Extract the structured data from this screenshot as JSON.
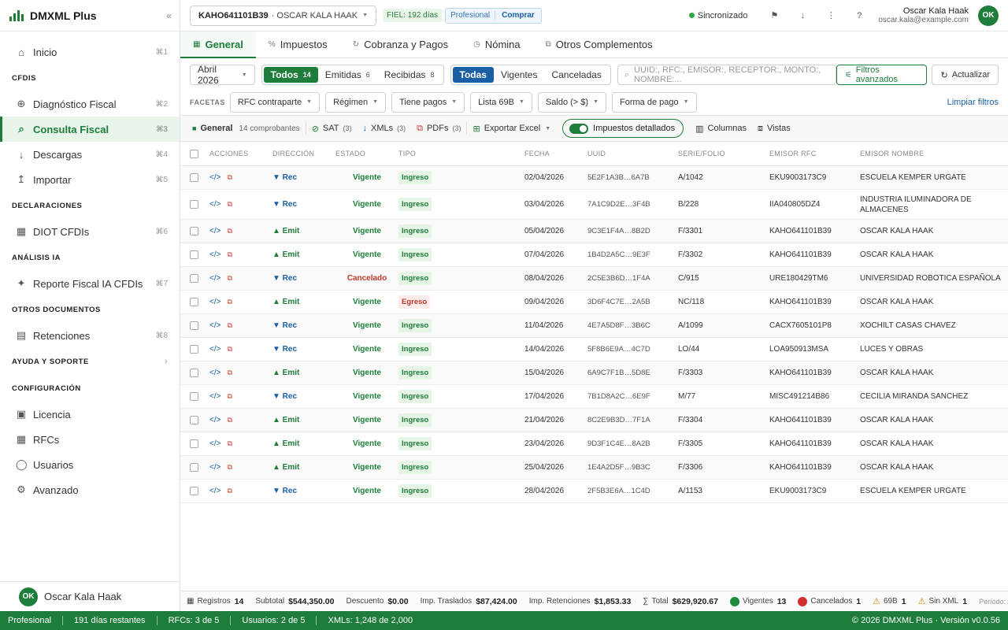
{
  "sidebar": {
    "brand": "DMXML Plus",
    "collapse_icon": "«",
    "items": [
      {
        "id": "inicio",
        "label": "Inicio",
        "icon": "⌂",
        "shortcut": "⌘1"
      },
      {
        "id": "sec-cfdis",
        "section": "CFDIS"
      },
      {
        "id": "diagnostico",
        "label": "Diagnóstico Fiscal",
        "icon": "⊕",
        "shortcut": "⌘2"
      },
      {
        "id": "consulta",
        "label": "Consulta Fiscal",
        "icon": "⌕",
        "shortcut": "⌘3",
        "active": true
      },
      {
        "id": "descargas",
        "label": "Descargas",
        "icon": "↓",
        "shortcut": "⌘4"
      },
      {
        "id": "importar",
        "label": "Importar",
        "icon": "↥",
        "shortcut": "⌘5"
      },
      {
        "id": "sec-decl",
        "section": "DECLARACIONES"
      },
      {
        "id": "diot",
        "label": "DIOT CFDIs",
        "icon": "▦",
        "shortcut": "⌘6"
      },
      {
        "id": "sec-ia",
        "section": "ANÁLISIS IA"
      },
      {
        "id": "reporte",
        "label": "Reporte Fiscal IA CFDIs",
        "icon": "✦",
        "shortcut": "⌘7"
      },
      {
        "id": "sec-otros",
        "section": "OTROS DOCUMENTOS"
      },
      {
        "id": "retenciones",
        "label": "Retenciones",
        "icon": "▤",
        "shortcut": "⌘8"
      },
      {
        "id": "sec-ayuda",
        "section": "AYUDA Y SOPORTE",
        "chevron": "›"
      },
      {
        "id": "sec-config",
        "section": "CONFIGURACIÓN"
      },
      {
        "id": "licencia",
        "label": "Licencia",
        "icon": "▣",
        "shortcut": ""
      },
      {
        "id": "rfcs",
        "label": "RFCs",
        "icon": "▦",
        "shortcut": ""
      },
      {
        "id": "usuarios",
        "label": "Usuarios",
        "icon": "◯",
        "shortcut": ""
      },
      {
        "id": "avanzado",
        "label": "Avanzado",
        "icon": "⚙",
        "shortcut": ""
      }
    ],
    "user": {
      "initials": "OK",
      "name": "Oscar Kala Haak"
    }
  },
  "topbar": {
    "rfc": "KAHO641101B39",
    "rfc_name": "· OSCAR KALA HAAK",
    "fiel": "FIEL: 192 días",
    "plan": "Profesional",
    "buy": "Comprar",
    "sync": "Sincronizado",
    "icons": [
      "⚑",
      "↓",
      "⋮",
      "?"
    ],
    "user_name": "Oscar Kala Haak",
    "user_email": "oscar.kala@example.com",
    "initials": "OK"
  },
  "tabs": [
    {
      "label": "General",
      "icon": "▦",
      "active": true
    },
    {
      "label": "Impuestos",
      "icon": "%"
    },
    {
      "label": "Cobranza y Pagos",
      "icon": "↻"
    },
    {
      "label": "Nómina",
      "icon": "◷"
    },
    {
      "label": "Otros Complementos",
      "icon": "⧉"
    }
  ],
  "filters": {
    "month": "Abril 2026",
    "dir_seg": [
      {
        "label": "Todos",
        "count": "14",
        "active": true
      },
      {
        "label": "Emitidas",
        "count": "6"
      },
      {
        "label": "Recibidas",
        "count": "8"
      }
    ],
    "status_seg": [
      {
        "label": "Todas",
        "active": true
      },
      {
        "label": "Vigentes"
      },
      {
        "label": "Canceladas"
      }
    ],
    "search_placeholder": "UUID:, RFC:, EMISOR:, RECEPTOR:, MONTO:, NOMBRE:...",
    "advanced": "Filtros avanzados",
    "refresh": "Actualizar"
  },
  "facets": {
    "label": "FACETAS",
    "items": [
      "RFC contraparte",
      "Régimen",
      "Tiene pagos",
      "Lista 69B",
      "Saldo (> $)",
      "Forma de pago"
    ],
    "clear": "Limpiar filtros"
  },
  "toolbar": {
    "group": "General",
    "group_count": "14 comprobantes",
    "sat": "SAT",
    "sat_count": "(3)",
    "xmls": "XMLs",
    "xmls_count": "(3)",
    "pdfs": "PDFs",
    "pdfs_count": "(3)",
    "export": "Exportar Excel",
    "taxes_toggle": "Impuestos detallados",
    "columns": "Columnas",
    "views": "Vistas"
  },
  "table": {
    "columns": [
      "ACCIONES",
      "DIRECCIÓN",
      "ESTADO",
      "TIPO",
      "FECHA",
      "UUID",
      "SERIE/FOLIO",
      "EMISOR RFC",
      "EMISOR NOMBRE"
    ],
    "rows": [
      {
        "dir": "▼ Rec",
        "estado": "Vigente",
        "tipo": "Ingreso",
        "fecha": "02/04/2026",
        "uuid": "5E2F1A3B…6A7B",
        "serie": "A/1042",
        "rfc": "EKU9003173C9",
        "nombre": "ESCUELA KEMPER URGATE"
      },
      {
        "dir": "▼ Rec",
        "estado": "Vigente",
        "tipo": "Ingreso",
        "fecha": "03/04/2026",
        "uuid": "7A1C9D2E…3F4B",
        "serie": "B/228",
        "rfc": "IIA040805DZ4",
        "nombre": "INDUSTRIA ILUMINADORA DE ALMACENES"
      },
      {
        "dir": "▲ Emit",
        "estado": "Vigente",
        "tipo": "Ingreso",
        "fecha": "05/04/2026",
        "uuid": "9C3E1F4A…8B2D",
        "serie": "F/3301",
        "rfc": "KAHO641101B39",
        "nombre": "OSCAR KALA HAAK"
      },
      {
        "dir": "▲ Emit",
        "estado": "Vigente",
        "tipo": "Ingreso",
        "fecha": "07/04/2026",
        "uuid": "1B4D2A5C…9E3F",
        "serie": "F/3302",
        "rfc": "KAHO641101B39",
        "nombre": "OSCAR KALA HAAK"
      },
      {
        "dir": "▼ Rec",
        "estado": "Cancelado",
        "tipo": "Ingreso",
        "fecha": "08/04/2026",
        "uuid": "2C5E3B6D…1F4A",
        "serie": "C/915",
        "rfc": "URE180429TM6",
        "nombre": "UNIVERSIDAD ROBOTICA ESPAÑOLA"
      },
      {
        "dir": "▲ Emit",
        "estado": "Vigente",
        "tipo": "Egreso",
        "fecha": "09/04/2026",
        "uuid": "3D6F4C7E…2A5B",
        "serie": "NC/118",
        "rfc": "KAHO641101B39",
        "nombre": "OSCAR KALA HAAK"
      },
      {
        "dir": "▼ Rec",
        "estado": "Vigente",
        "tipo": "Ingreso",
        "fecha": "11/04/2026",
        "uuid": "4E7A5D8F…3B6C",
        "serie": "A/1099",
        "rfc": "CACX7605101P8",
        "nombre": "XOCHILT CASAS CHAVEZ"
      },
      {
        "dir": "▼ Rec",
        "estado": "Vigente",
        "tipo": "Ingreso",
        "fecha": "14/04/2026",
        "uuid": "5F8B6E9A…4C7D",
        "serie": "LO/44",
        "rfc": "LOA950913MSA",
        "nombre": "LUCES Y OBRAS"
      },
      {
        "dir": "▲ Emit",
        "estado": "Vigente",
        "tipo": "Ingreso",
        "fecha": "15/04/2026",
        "uuid": "6A9C7F1B…5D8E",
        "serie": "F/3303",
        "rfc": "KAHO641101B39",
        "nombre": "OSCAR KALA HAAK"
      },
      {
        "dir": "▼ Rec",
        "estado": "Vigente",
        "tipo": "Ingreso",
        "fecha": "17/04/2026",
        "uuid": "7B1D8A2C…6E9F",
        "serie": "M/77",
        "rfc": "MISC491214B86",
        "nombre": "CECILIA MIRANDA SANCHEZ"
      },
      {
        "dir": "▲ Emit",
        "estado": "Vigente",
        "tipo": "Ingreso",
        "fecha": "21/04/2026",
        "uuid": "8C2E9B3D…7F1A",
        "serie": "F/3304",
        "rfc": "KAHO641101B39",
        "nombre": "OSCAR KALA HAAK"
      },
      {
        "dir": "▲ Emit",
        "estado": "Vigente",
        "tipo": "Ingreso",
        "fecha": "23/04/2026",
        "uuid": "9D3F1C4E…8A2B",
        "serie": "F/3305",
        "rfc": "KAHO641101B39",
        "nombre": "OSCAR KALA HAAK"
      },
      {
        "dir": "▲ Emit",
        "estado": "Vigente",
        "tipo": "Ingreso",
        "fecha": "25/04/2026",
        "uuid": "1E4A2D5F…9B3C",
        "serie": "F/3306",
        "rfc": "KAHO641101B39",
        "nombre": "OSCAR KALA HAAK"
      },
      {
        "dir": "▼ Rec",
        "estado": "Vigente",
        "tipo": "Ingreso",
        "fecha": "28/04/2026",
        "uuid": "2F5B3E6A…1C4D",
        "serie": "A/1153",
        "rfc": "EKU9003173C9",
        "nombre": "ESCUELA KEMPER URGATE"
      }
    ]
  },
  "footer": [
    {
      "id": "registros",
      "label": "Registros",
      "value": "14",
      "icon": "▦"
    },
    {
      "id": "subtotal",
      "label": "Subtotal",
      "value": "$544,350.00"
    },
    {
      "id": "descuento",
      "label": "Descuento",
      "value": "$0.00"
    },
    {
      "id": "traslados",
      "label": "Imp. Traslados",
      "value": "$87,424.00"
    },
    {
      "id": "retenciones",
      "label": "Imp. Retenciones",
      "value": "$1,853.33"
    },
    {
      "id": "total",
      "label": "Total",
      "value": "$629,920.67",
      "icon": "∑"
    },
    {
      "id": "vigentes",
      "label": "Vigentes",
      "value": "13",
      "dot": "green"
    },
    {
      "id": "cancelados",
      "label": "Cancelados",
      "value": "1",
      "dot": "red"
    },
    {
      "id": "69b",
      "label": "69B",
      "value": "1",
      "warn": true
    },
    {
      "id": "sinxml",
      "label": "Sin XML",
      "value": "1",
      "warn": true
    }
  ],
  "footer_period": "Período: A",
  "statusbar": {
    "items": [
      "Profesional",
      "191 días restantes",
      "RFCs: 3 de 5",
      "Usuarios: 2 de 5",
      "XMLs: 1,248 de 2,000"
    ],
    "copyright": "© 2026 DMXML Plus · Versión v0.0.56"
  },
  "colors": {
    "brand": "#1e7d3a",
    "link": "#1a5fa3",
    "danger": "#c0392b"
  }
}
